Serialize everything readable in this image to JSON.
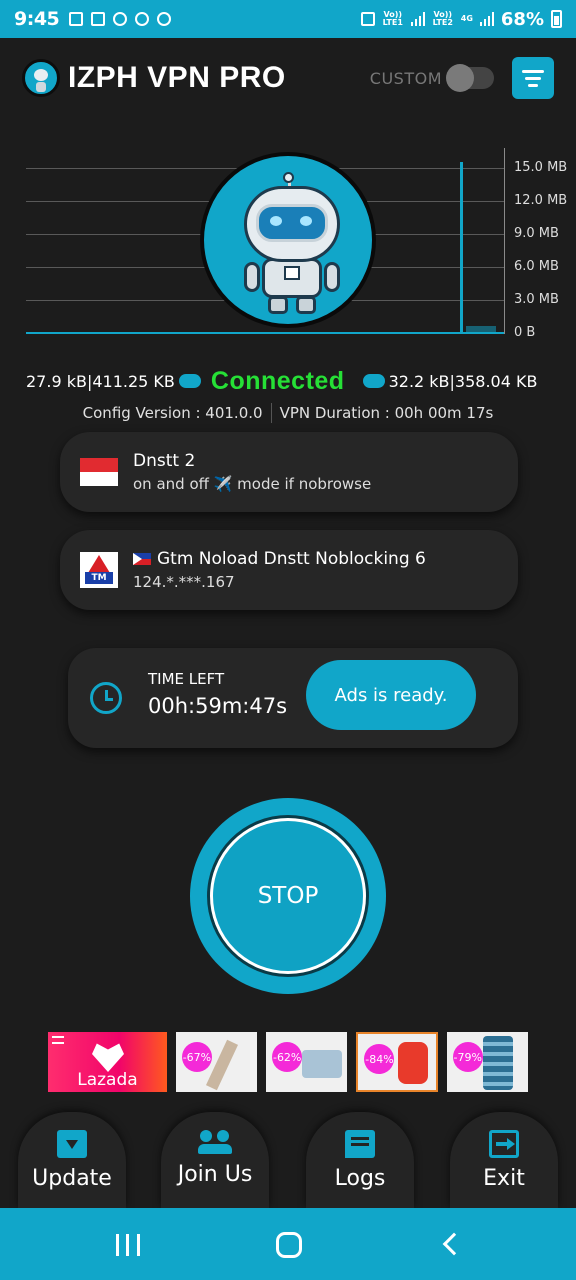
{
  "status_bar": {
    "time": "9:45",
    "sim1": "Vo)) LTE1",
    "sim2": "Vo)) LTE2",
    "network": "4G",
    "battery": "68%"
  },
  "header": {
    "title": "IZPH VPN PRO",
    "custom_label": "CUSTOM",
    "custom_toggle_on": false
  },
  "graph": {
    "scale_labels": [
      "15.0 MB",
      "12.0 MB",
      "9.0 MB",
      "6.0 MB",
      "3.0 MB",
      "0 B"
    ]
  },
  "stats": {
    "upload": "27.9 kB|411.25 KB",
    "status": "Connected",
    "download": "32.2 kB|358.04 KB",
    "config_version": "Config Version : 401.0.0",
    "vpn_duration": "VPN Duration : 00h 00m 17s"
  },
  "server": {
    "name": "Dnstt 2",
    "description": "on and off ✈️ mode if nobrowse"
  },
  "network": {
    "name": "Gtm Noload Dnstt Noblocking 6",
    "ip": "124.*.***.167"
  },
  "timer": {
    "label": "TIME LEFT",
    "value": "00h:59m:47s",
    "ads_button": "Ads is ready."
  },
  "connect_button": {
    "label": "STOP"
  },
  "ads": {
    "brand": "Lazada",
    "discounts": [
      "-67%",
      "-62%",
      "-84%",
      "-79%"
    ]
  },
  "actions": [
    {
      "label": "Update",
      "icon": "download-box-icon"
    },
    {
      "label": "Join Us",
      "icon": "group-icon"
    },
    {
      "label": "Logs",
      "icon": "chat-icon"
    },
    {
      "label": "Exit",
      "icon": "exit-icon"
    }
  ],
  "colors": {
    "accent": "#11a6c9",
    "background": "#1c1c1c",
    "connected": "#26e036"
  }
}
